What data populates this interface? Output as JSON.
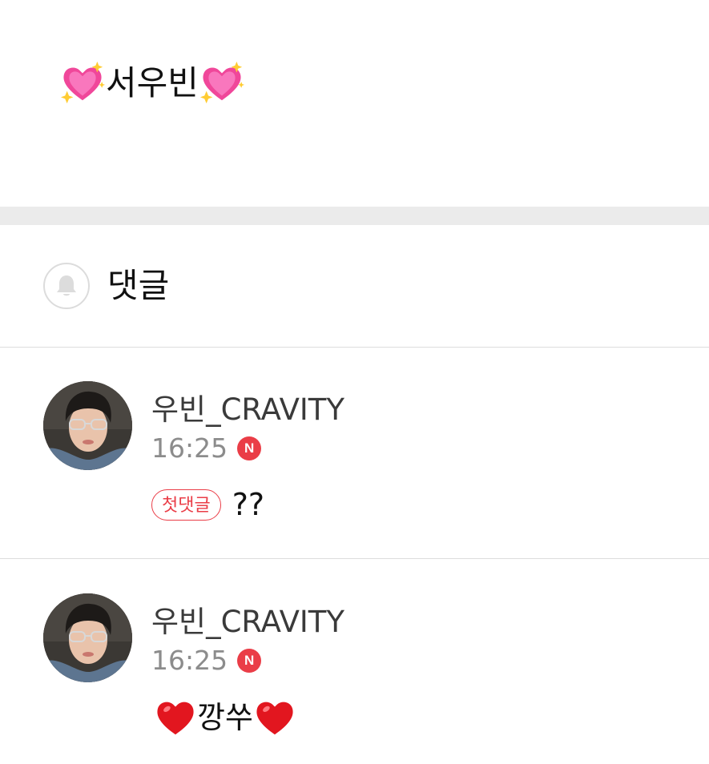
{
  "post": {
    "text": "서우빈",
    "leading_icon": "sparkling-heart-icon",
    "trailing_icon": "sparkling-heart-icon"
  },
  "comments_section": {
    "title": "댓글",
    "bell_icon": "bell-icon"
  },
  "comments": [
    {
      "author": "우빈_CRAVITY",
      "time": "16:25",
      "new_badge": "N",
      "tag": "첫댓글",
      "text": "??"
    },
    {
      "author": "우빈_CRAVITY",
      "time": "16:25",
      "new_badge": "N",
      "text": "깡쑤",
      "leading_icon": "red-heart-icon",
      "trailing_icon": "red-heart-icon"
    }
  ],
  "colors": {
    "accent_red": "#ea3d47",
    "divider_band": "#ebebeb",
    "meta_gray": "#8c8c8c"
  }
}
